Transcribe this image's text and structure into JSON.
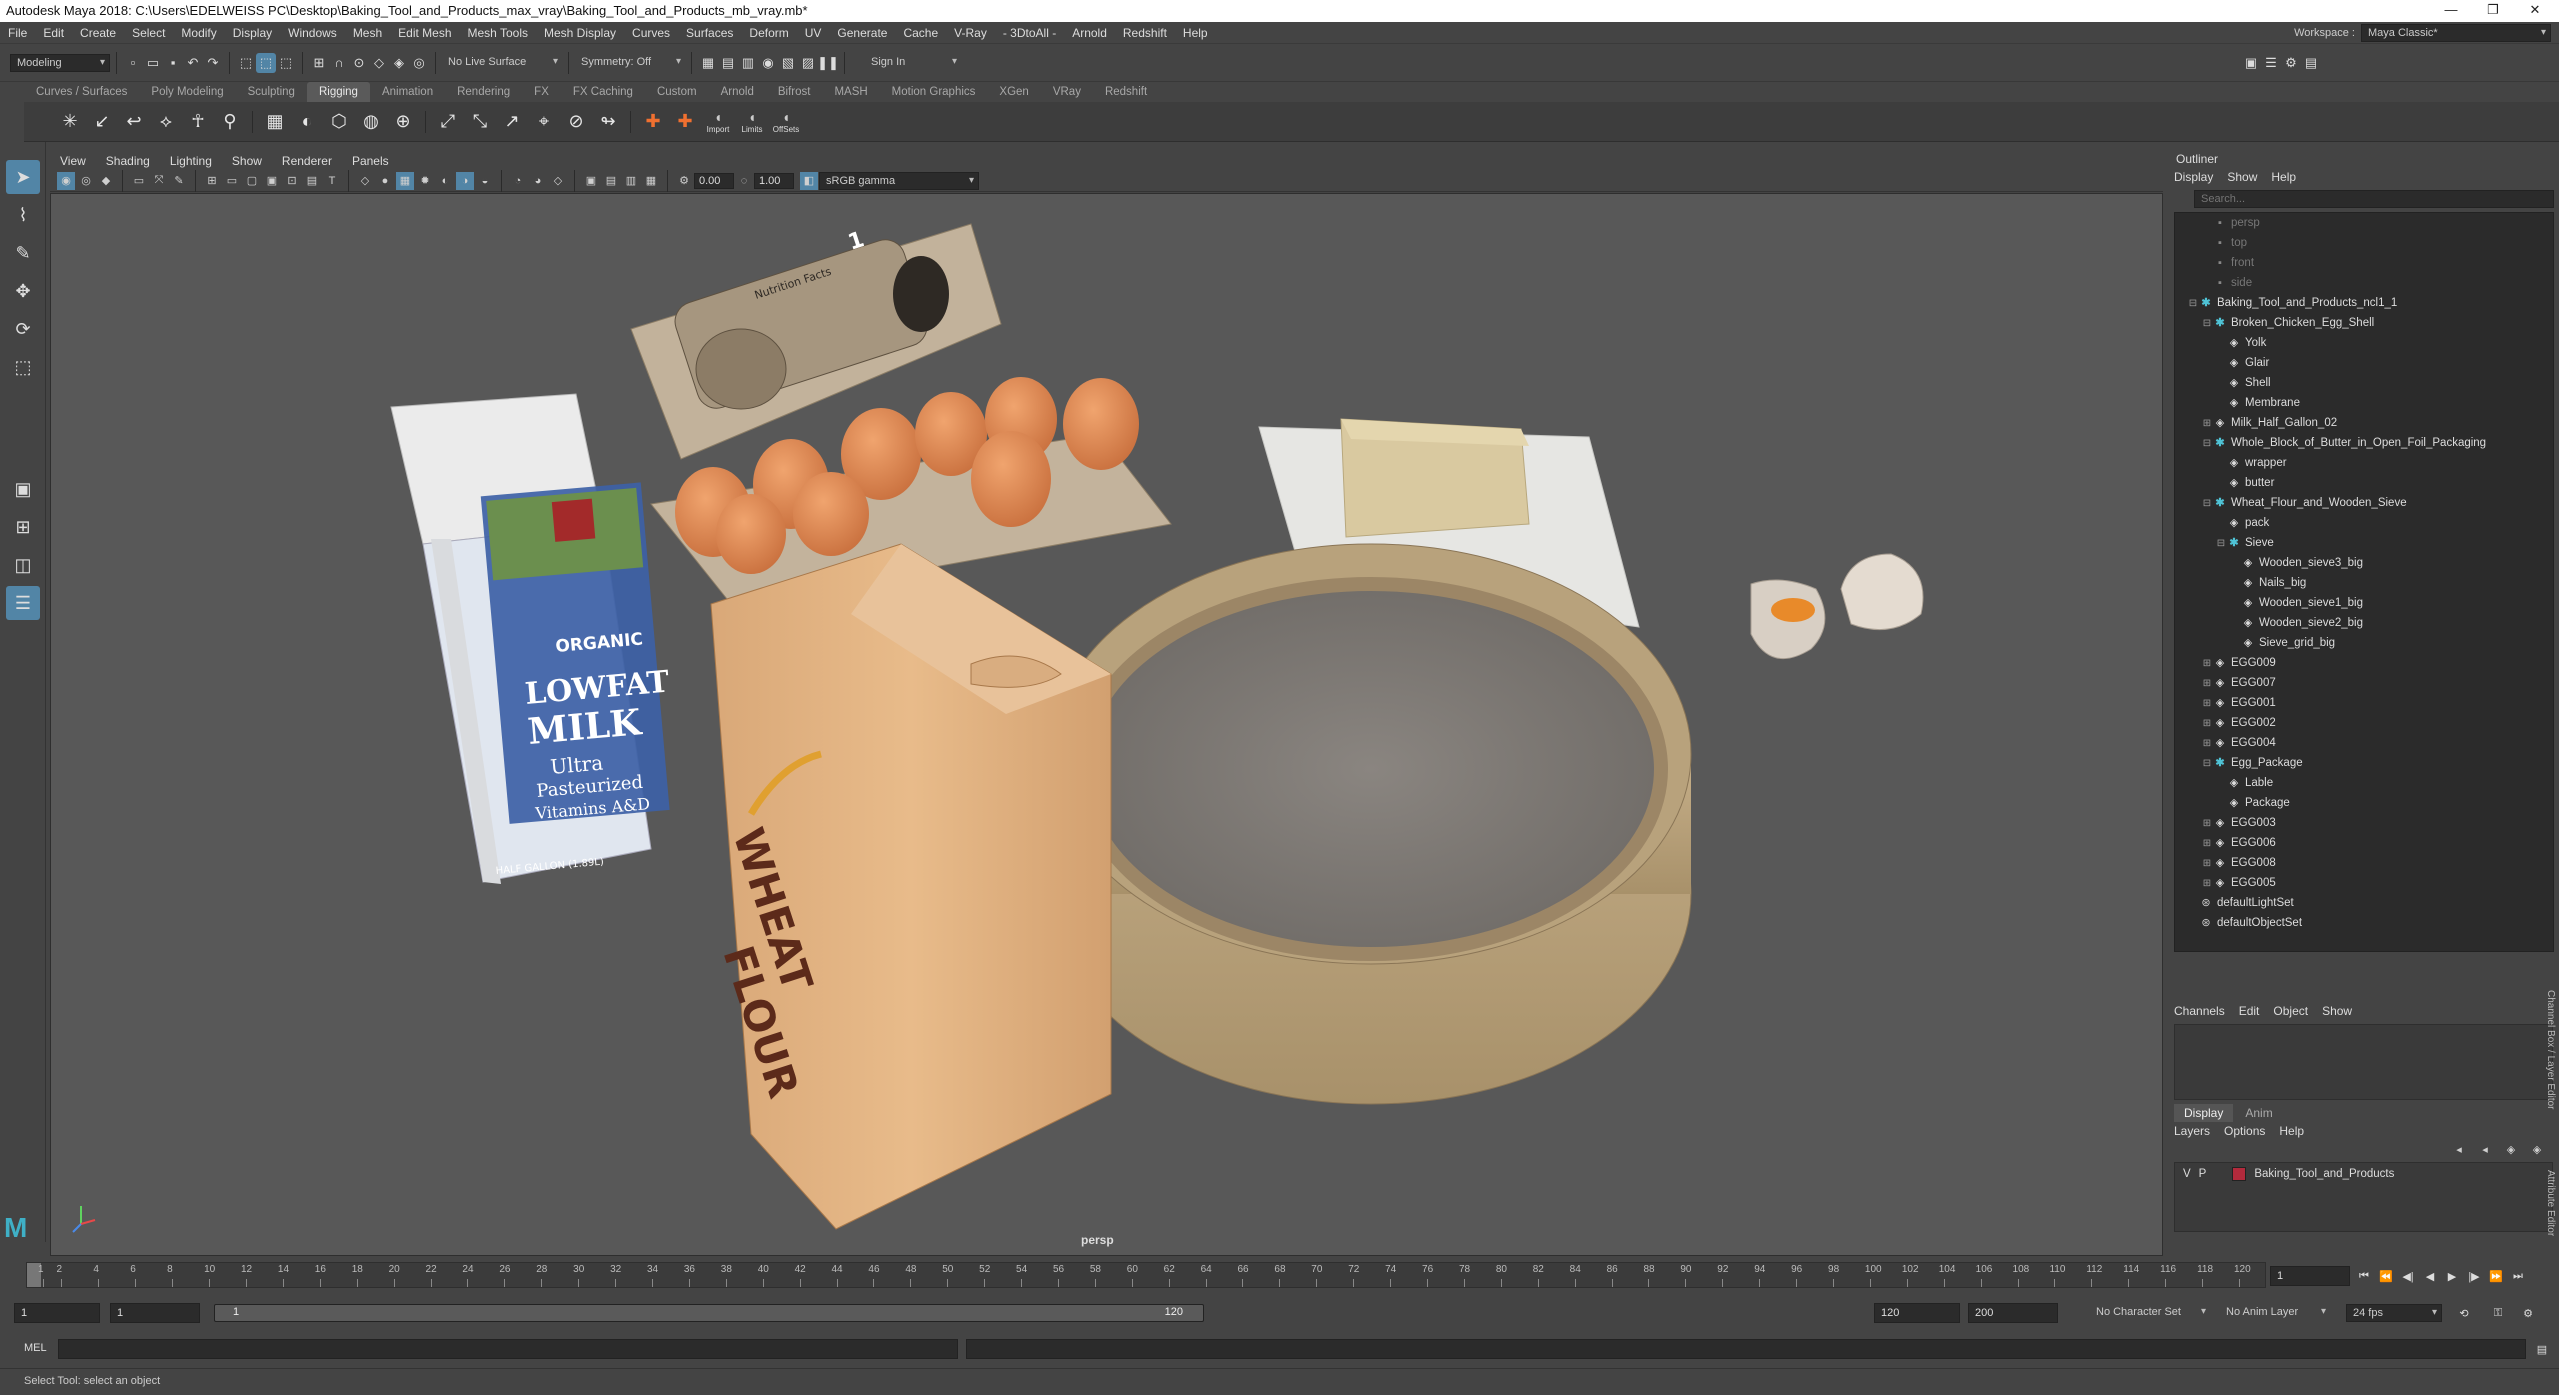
{
  "titlebar": {
    "title": "Autodesk Maya 2018: C:\\Users\\EDELWEISS PC\\Desktop\\Baking_Tool_and_Products_max_vray\\Baking_Tool_and_Products_mb_vray.mb*",
    "minimize": "—",
    "maximize": "❐",
    "close": "✕"
  },
  "menubar": {
    "items": [
      "File",
      "Edit",
      "Create",
      "Select",
      "Modify",
      "Display",
      "Windows",
      "Mesh",
      "Edit Mesh",
      "Mesh Tools",
      "Mesh Display",
      "Curves",
      "Surfaces",
      "Deform",
      "UV",
      "Generate",
      "Cache",
      "V-Ray",
      "- 3DtoAll -",
      "Arnold",
      "Redshift",
      "Help"
    ],
    "workspace_label": "Workspace :",
    "workspace_value": "Maya Classic*"
  },
  "statusline": {
    "mode": "Modeling",
    "live_surface": "No Live Surface",
    "symmetry": "Symmetry: Off",
    "sign_in": "Sign In"
  },
  "shelf": {
    "tabs": [
      "Curves / Surfaces",
      "Poly Modeling",
      "Sculpting",
      "Rigging",
      "Animation",
      "Rendering",
      "FX",
      "FX Caching",
      "Custom",
      "Arnold",
      "Bifrost",
      "MASH",
      "Motion Graphics",
      "XGen",
      "VRay",
      "Redshift"
    ],
    "active_tab": "Rigging",
    "labels": [
      "Import",
      "Limits",
      "OffSets"
    ]
  },
  "viewport": {
    "menus": [
      "View",
      "Shading",
      "Lighting",
      "Show",
      "Renderer",
      "Panels"
    ],
    "exposure": "0.00",
    "gamma": "1.00",
    "colorspace": "sRGB gamma",
    "camera": "persp",
    "product_text": {
      "carton_title": "Nutrition Facts",
      "milk_organic": "ORGANIC",
      "milk_lowfat": "LOWFAT",
      "milk_milk": "MILK",
      "milk_sub1": "Ultra",
      "milk_sub2": "Pasteurized",
      "milk_sub3": "Vitamins A&D",
      "milk_bottom": "HALF GALLON (1.89L)",
      "flour1": "WHEAT",
      "flour2": "FLOUR"
    }
  },
  "outliner": {
    "title": "Outliner",
    "menus": [
      "Display",
      "Show",
      "Help"
    ],
    "search_placeholder": "Search...",
    "items": [
      {
        "label": "persp",
        "depth": 1,
        "kind": "cam",
        "dim": true,
        "exp": ""
      },
      {
        "label": "top",
        "depth": 1,
        "kind": "cam",
        "dim": true,
        "exp": ""
      },
      {
        "label": "front",
        "depth": 1,
        "kind": "cam",
        "dim": true,
        "exp": ""
      },
      {
        "label": "side",
        "depth": 1,
        "kind": "cam",
        "dim": true,
        "exp": ""
      },
      {
        "label": "Baking_Tool_and_Products_ncl1_1",
        "depth": 0,
        "kind": "group",
        "exp": "⊟"
      },
      {
        "label": "Broken_Chicken_Egg_Shell",
        "depth": 1,
        "kind": "group",
        "exp": "⊟"
      },
      {
        "label": "Yolk",
        "depth": 2,
        "kind": "mesh",
        "exp": ""
      },
      {
        "label": "Glair",
        "depth": 2,
        "kind": "mesh",
        "exp": ""
      },
      {
        "label": "Shell",
        "depth": 2,
        "kind": "mesh",
        "exp": ""
      },
      {
        "label": "Membrane",
        "depth": 2,
        "kind": "mesh",
        "exp": ""
      },
      {
        "label": "Milk_Half_Gallon_02",
        "depth": 1,
        "kind": "mesh",
        "exp": "⊞"
      },
      {
        "label": "Whole_Block_of_Butter_in_Open_Foil_Packaging",
        "depth": 1,
        "kind": "group",
        "exp": "⊟"
      },
      {
        "label": "wrapper",
        "depth": 2,
        "kind": "mesh",
        "exp": ""
      },
      {
        "label": "butter",
        "depth": 2,
        "kind": "mesh",
        "exp": ""
      },
      {
        "label": "Wheat_Flour_and_Wooden_Sieve",
        "depth": 1,
        "kind": "group",
        "exp": "⊟"
      },
      {
        "label": "pack",
        "depth": 2,
        "kind": "mesh",
        "exp": ""
      },
      {
        "label": "Sieve",
        "depth": 2,
        "kind": "group",
        "exp": "⊟"
      },
      {
        "label": "Wooden_sieve3_big",
        "depth": 3,
        "kind": "mesh",
        "exp": ""
      },
      {
        "label": "Nails_big",
        "depth": 3,
        "kind": "mesh",
        "exp": ""
      },
      {
        "label": "Wooden_sieve1_big",
        "depth": 3,
        "kind": "mesh",
        "exp": ""
      },
      {
        "label": "Wooden_sieve2_big",
        "depth": 3,
        "kind": "mesh",
        "exp": ""
      },
      {
        "label": "Sieve_grid_big",
        "depth": 3,
        "kind": "mesh",
        "exp": ""
      },
      {
        "label": "EGG009",
        "depth": 1,
        "kind": "mesh",
        "exp": "⊞"
      },
      {
        "label": "EGG007",
        "depth": 1,
        "kind": "mesh",
        "exp": "⊞"
      },
      {
        "label": "EGG001",
        "depth": 1,
        "kind": "mesh",
        "exp": "⊞"
      },
      {
        "label": "EGG002",
        "depth": 1,
        "kind": "mesh",
        "exp": "⊞"
      },
      {
        "label": "EGG004",
        "depth": 1,
        "kind": "mesh",
        "exp": "⊞"
      },
      {
        "label": "Egg_Package",
        "depth": 1,
        "kind": "group",
        "exp": "⊟"
      },
      {
        "label": "Lable",
        "depth": 2,
        "kind": "mesh",
        "exp": ""
      },
      {
        "label": "Package",
        "depth": 2,
        "kind": "mesh",
        "exp": ""
      },
      {
        "label": "EGG003",
        "depth": 1,
        "kind": "mesh",
        "exp": "⊞"
      },
      {
        "label": "EGG006",
        "depth": 1,
        "kind": "mesh",
        "exp": "⊞"
      },
      {
        "label": "EGG008",
        "depth": 1,
        "kind": "mesh",
        "exp": "⊞"
      },
      {
        "label": "EGG005",
        "depth": 1,
        "kind": "mesh",
        "exp": "⊞"
      },
      {
        "label": "defaultLightSet",
        "depth": 0,
        "kind": "set",
        "exp": ""
      },
      {
        "label": "defaultObjectSet",
        "depth": 0,
        "kind": "set",
        "exp": ""
      }
    ]
  },
  "channelbox": {
    "menus": [
      "Channels",
      "Edit",
      "Object",
      "Show"
    ],
    "tabs": [
      "Display",
      "Anim"
    ],
    "layer_menus": [
      "Layers",
      "Options",
      "Help"
    ],
    "layer": {
      "v": "V",
      "p": "P",
      "name": "Baking_Tool_and_Products"
    },
    "side_label1": "Channel Box / Layer Editor",
    "side_label2": "Attribute Editor"
  },
  "timeslider": {
    "ticks": [
      "1",
      "2",
      "4",
      "6",
      "8",
      "10",
      "12",
      "14",
      "16",
      "18",
      "20",
      "22",
      "24",
      "26",
      "28",
      "30",
      "32",
      "34",
      "36",
      "38",
      "40",
      "42",
      "44",
      "46",
      "48",
      "50",
      "52",
      "54",
      "56",
      "58",
      "60",
      "62",
      "64",
      "66",
      "68",
      "70",
      "72",
      "74",
      "76",
      "78",
      "80",
      "82",
      "84",
      "86",
      "88",
      "90",
      "92",
      "94",
      "96",
      "98",
      "100",
      "102",
      "104",
      "106",
      "108",
      "110",
      "112",
      "114",
      "116",
      "118",
      "120"
    ],
    "current_frame": "1"
  },
  "rangeslider": {
    "start": "1",
    "anim_start": "1",
    "range_start": "1",
    "range_end": "120",
    "end": "120",
    "anim_end": "200",
    "character_set": "No Character Set",
    "anim_layer": "No Anim Layer",
    "fps": "24 fps"
  },
  "cmdline": {
    "label": "MEL"
  },
  "helpline": {
    "text": "Select Tool: select an object"
  }
}
